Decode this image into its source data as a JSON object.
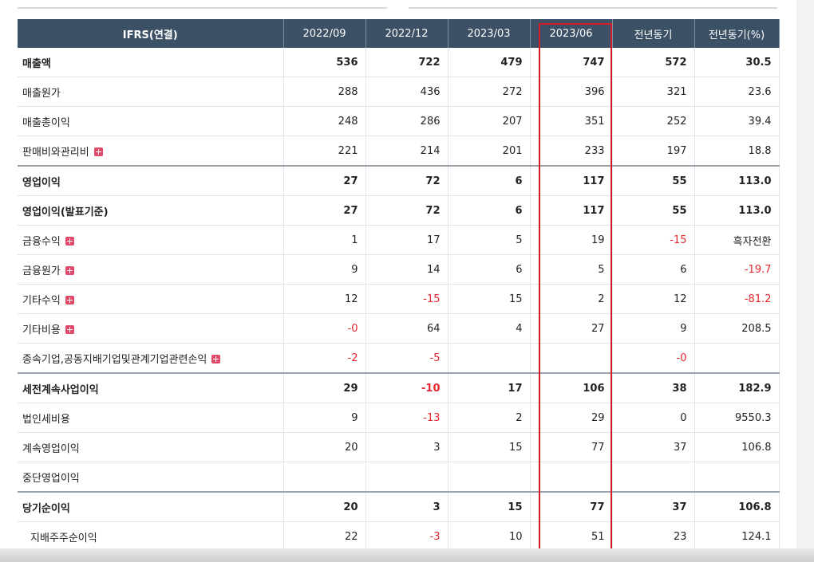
{
  "columns": [
    "IFRS(연결)",
    "2022/09",
    "2022/12",
    "2023/03",
    "2023/06",
    "전년동기",
    "전년동기(%)"
  ],
  "rows": [
    {
      "label": "매출액",
      "values": [
        "536",
        "722",
        "479",
        "747",
        "572",
        "30.5"
      ],
      "bold": true,
      "expand": false
    },
    {
      "label": "매출원가",
      "values": [
        "288",
        "436",
        "272",
        "396",
        "321",
        "23.6"
      ],
      "bold": false,
      "expand": false
    },
    {
      "label": "매출총이익",
      "values": [
        "248",
        "286",
        "207",
        "351",
        "252",
        "39.4"
      ],
      "bold": false,
      "expand": false
    },
    {
      "label": "판매비와관리비",
      "values": [
        "221",
        "214",
        "201",
        "233",
        "197",
        "18.8"
      ],
      "bold": false,
      "expand": true
    },
    {
      "label": "영업이익",
      "values": [
        "27",
        "72",
        "6",
        "117",
        "55",
        "113.0"
      ],
      "bold": true,
      "expand": false
    },
    {
      "label": "영업이익(발표기준)",
      "values": [
        "27",
        "72",
        "6",
        "117",
        "55",
        "113.0"
      ],
      "bold": true,
      "expand": false
    },
    {
      "label": "금융수익",
      "values": [
        "1",
        "17",
        "5",
        "19",
        "-15",
        "흑자전환"
      ],
      "bold": false,
      "expand": true
    },
    {
      "label": "금융원가",
      "values": [
        "9",
        "14",
        "6",
        "5",
        "6",
        "-19.7"
      ],
      "bold": false,
      "expand": true
    },
    {
      "label": "기타수익",
      "values": [
        "12",
        "-15",
        "15",
        "2",
        "12",
        "-81.2"
      ],
      "bold": false,
      "expand": true
    },
    {
      "label": "기타비용",
      "values": [
        "-0",
        "64",
        "4",
        "27",
        "9",
        "208.5"
      ],
      "bold": false,
      "expand": true
    },
    {
      "label": "종속기업,공동지배기업및관계기업관련손익",
      "values": [
        "-2",
        "-5",
        "",
        "",
        "-0",
        ""
      ],
      "bold": false,
      "expand": true
    },
    {
      "label": "세전계속사업이익",
      "values": [
        "29",
        "-10",
        "17",
        "106",
        "38",
        "182.9"
      ],
      "bold": true,
      "expand": false
    },
    {
      "label": "법인세비용",
      "values": [
        "9",
        "-13",
        "2",
        "29",
        "0",
        "9550.3"
      ],
      "bold": false,
      "expand": false
    },
    {
      "label": "계속영업이익",
      "values": [
        "20",
        "3",
        "15",
        "77",
        "37",
        "106.8"
      ],
      "bold": false,
      "expand": false
    },
    {
      "label": "중단영업이익",
      "values": [
        "",
        "",
        "",
        "",
        "",
        ""
      ],
      "bold": false,
      "expand": false
    },
    {
      "label": "당기순이익",
      "values": [
        "20",
        "3",
        "15",
        "77",
        "37",
        "106.8"
      ],
      "bold": true,
      "expand": false
    },
    {
      "label": "지배주주순이익",
      "values": [
        "22",
        "-3",
        "10",
        "51",
        "23",
        "124.1"
      ],
      "bold": false,
      "expand": false
    }
  ],
  "colors": {
    "header_bg": "#3c5066",
    "negative": "#e8262e",
    "highlight_border": "#d21d26"
  }
}
